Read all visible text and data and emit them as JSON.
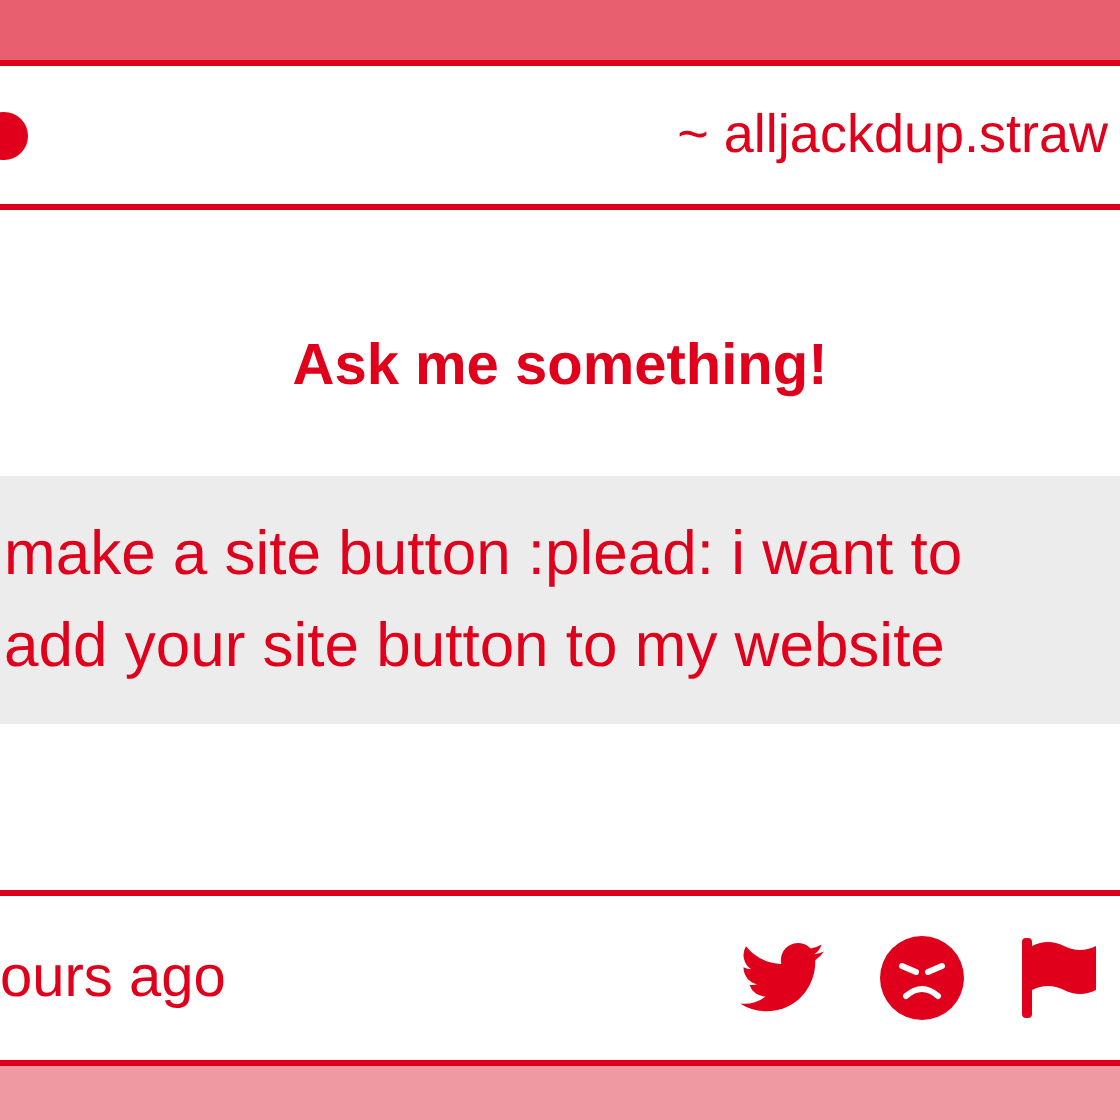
{
  "header": {
    "url": "~ alljackdup.straw"
  },
  "title": "Ask me something!",
  "question": {
    "lines": [
      "make a site button :plead: i want to",
      "add your site button to my website"
    ]
  },
  "footer": {
    "time": "ours ago"
  }
}
